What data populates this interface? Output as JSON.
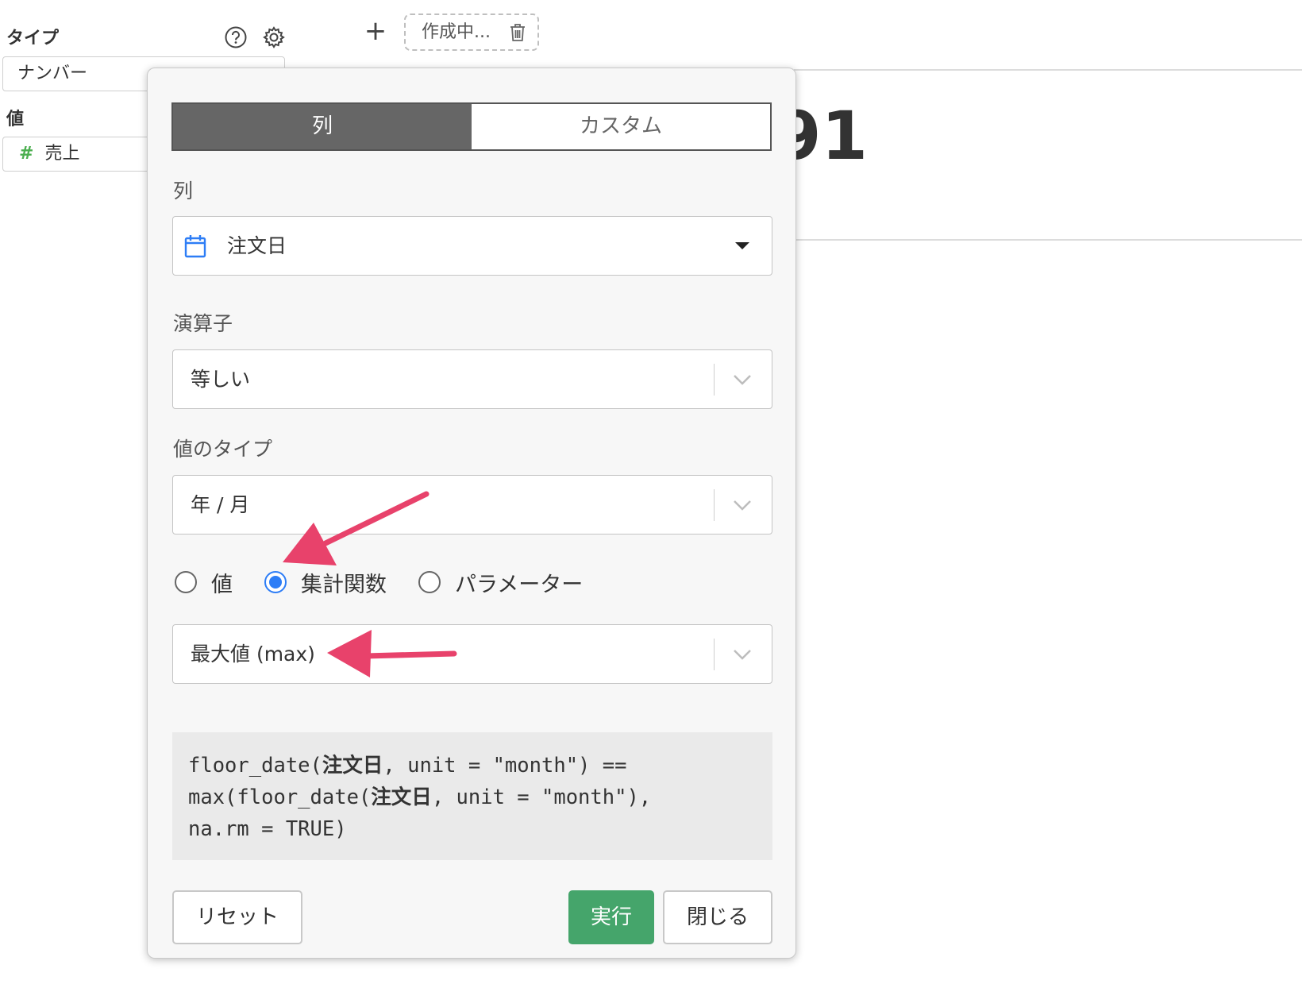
{
  "sidebar": {
    "type_label": "タイプ",
    "type_value": "ナンバー",
    "value_label": "値",
    "value_field_icon": "#",
    "value_field": "売上",
    "help_icon": "question-circle-icon",
    "settings_icon": "gear-icon"
  },
  "topbar": {
    "add_label": "+",
    "draft_tab_label": "作成中...",
    "trash_icon": "trash-icon"
  },
  "background": {
    "number_fragment": "91"
  },
  "popup": {
    "tabs": [
      {
        "label": "列",
        "active": true
      },
      {
        "label": "カスタム",
        "active": false
      }
    ],
    "column": {
      "label": "列",
      "value": "注文日",
      "icon": "calendar-icon"
    },
    "operator": {
      "label": "演算子",
      "value": "等しい"
    },
    "value_type": {
      "label": "値のタイプ",
      "value": "年 / 月"
    },
    "radio_options": [
      {
        "label": "値",
        "checked": false
      },
      {
        "label": "集計関数",
        "checked": true
      },
      {
        "label": "パラメーター",
        "checked": false
      }
    ],
    "aggregate": {
      "value": "最大値 (max)"
    },
    "code": {
      "line1_a": "floor_date(",
      "line1_b": "注文日",
      "line1_c": ", unit = \"month\") ==",
      "line2_a": "max(floor_date(",
      "line2_b": "注文日",
      "line2_c": ", unit = \"month\"),",
      "line3": "na.rm = TRUE)"
    },
    "buttons": {
      "reset": "リセット",
      "run": "実行",
      "close": "閉じる"
    }
  },
  "colors": {
    "accent_blue": "#2d7df6",
    "run_green": "#45a56b",
    "annotation_arrow": "#e8426b",
    "segment_active": "#666666"
  }
}
